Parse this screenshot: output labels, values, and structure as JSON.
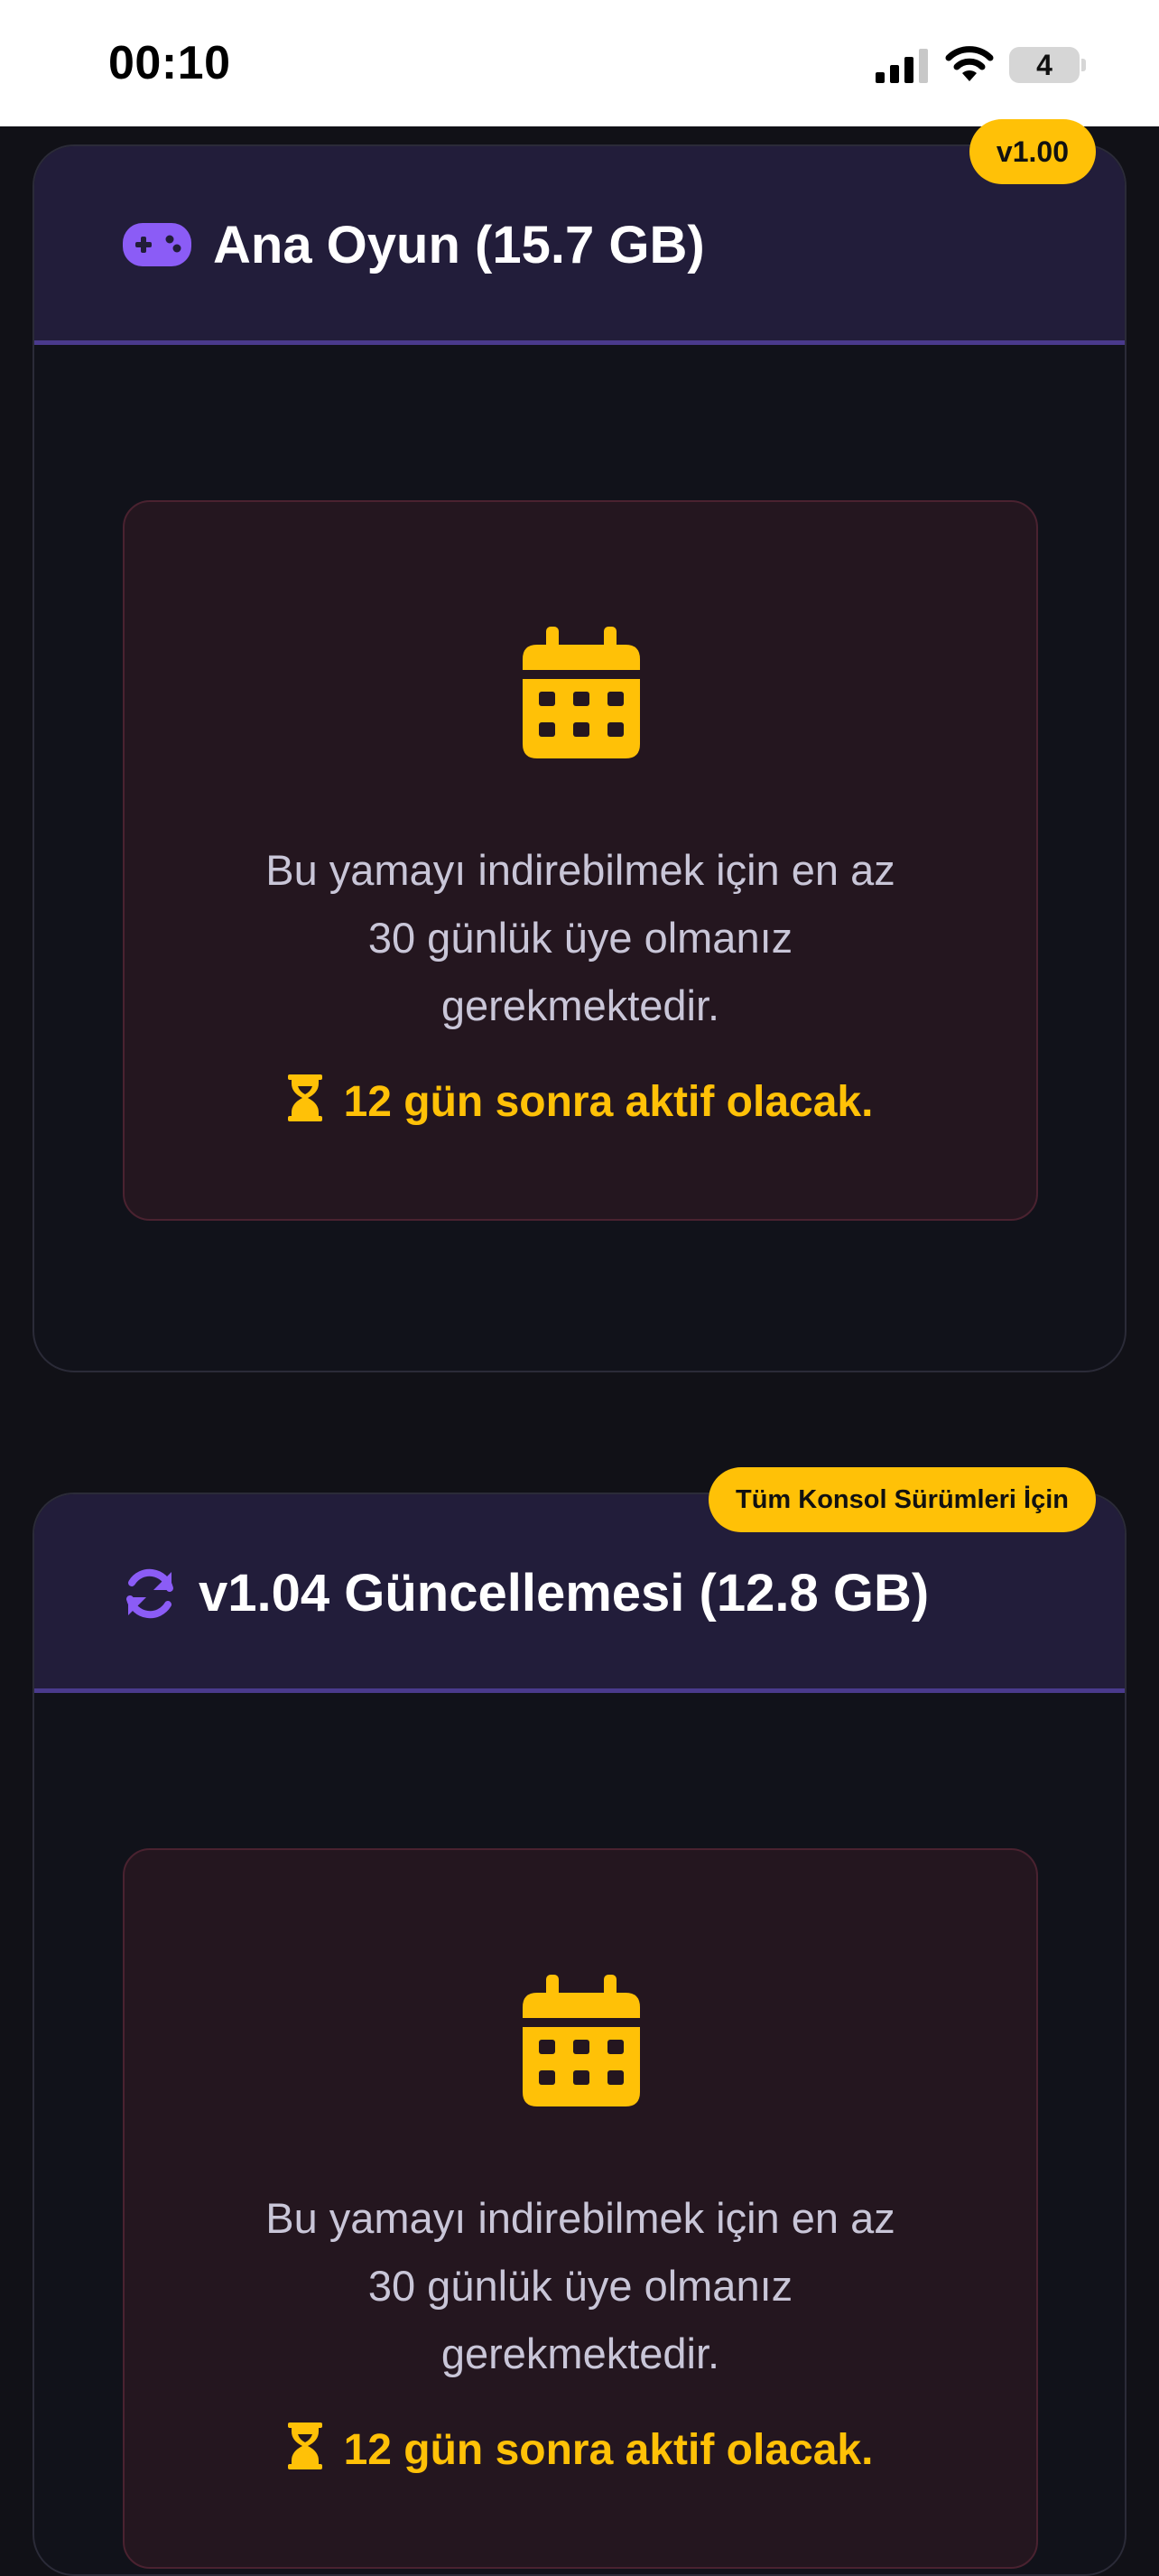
{
  "status_bar": {
    "time": "00:10",
    "battery": "4",
    "icons": [
      "signal-icon",
      "wifi-icon",
      "battery-icon"
    ]
  },
  "cards": [
    {
      "title": "Ana Oyun (15.7 GB)",
      "icon": "gamepad-icon",
      "badge": "v1.00",
      "lock": {
        "icon": "calendar-icon",
        "message_lines": [
          "Bu yamayı indirebilmek için en az",
          "30 günlük üye olmanız",
          "gerekmektedir."
        ],
        "countdown_icon": "hourglass-icon",
        "countdown": "12 gün sonra aktif olacak."
      }
    },
    {
      "title": "v1.04 Güncellemesi (12.8 GB)",
      "icon": "sync-icon",
      "badge": "Tüm Konsol Sürümleri İçin",
      "lock": {
        "icon": "calendar-icon",
        "message_lines": [
          "Bu yamayı indirebilmek için en az",
          "30 günlük üye olmanız",
          "gerekmektedir."
        ],
        "countdown_icon": "hourglass-icon",
        "countdown": "12 gün sonra aktif olacak."
      }
    }
  ],
  "colors": {
    "accent_yellow": "#ffc107",
    "accent_purple": "#8b5cf6",
    "header_bg": "#221d3a",
    "page_bg": "#111117",
    "lock_bg": "#24161f"
  }
}
